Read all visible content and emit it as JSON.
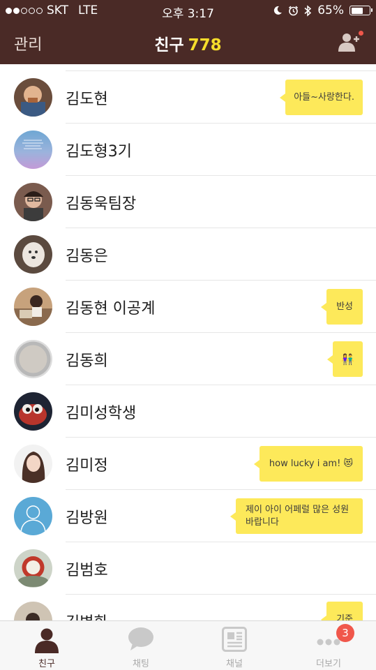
{
  "status_bar": {
    "carrier": "SKT",
    "network": "LTE",
    "time": "오후 3:17",
    "battery": "65%",
    "battery_level": 0.65
  },
  "header": {
    "manage_label": "관리",
    "title": "친구",
    "friend_count": "778"
  },
  "friends": [
    {
      "name": "김도현",
      "status": "아들~사랑한다."
    },
    {
      "name": "김도형3기",
      "status": ""
    },
    {
      "name": "김동욱팀장",
      "status": ""
    },
    {
      "name": "김동은",
      "status": ""
    },
    {
      "name": "김동현 이공계",
      "status": "반성"
    },
    {
      "name": "김동희",
      "status": "👫"
    },
    {
      "name": "김미성학생",
      "status": ""
    },
    {
      "name": "김미정",
      "status": "how lucky i am! 😻"
    },
    {
      "name": "김방원",
      "status": "제이 아이 어페럴 많은 성원 바랍니다"
    },
    {
      "name": "김범호",
      "status": ""
    },
    {
      "name": "김병화",
      "status": "기준"
    }
  ],
  "tabs": [
    {
      "label": "친구",
      "icon": "friends-icon",
      "active": true
    },
    {
      "label": "채팅",
      "icon": "chat-icon",
      "active": false
    },
    {
      "label": "채널",
      "icon": "channel-icon",
      "active": false
    },
    {
      "label": "더보기",
      "icon": "more-icon",
      "active": false,
      "badge": "3"
    }
  ],
  "colors": {
    "header_bg": "#4a2a26",
    "count_yellow": "#f6dd2b",
    "bubble_yellow": "#fde95a",
    "badge_red": "#f0574b"
  }
}
